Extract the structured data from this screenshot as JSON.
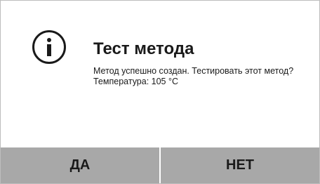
{
  "dialog": {
    "icon": "info-circle-icon",
    "title": "Тест метода",
    "message_line1": "Метод успешно создан. Тестировать этот метод?",
    "message_line2": "Температура: 105 °C"
  },
  "buttons": {
    "yes_label": "ДА",
    "no_label": "НЕТ"
  },
  "colors": {
    "button_bg": "#a8a8a8",
    "text": "#1a1a1a",
    "border": "#bdbdbd"
  }
}
